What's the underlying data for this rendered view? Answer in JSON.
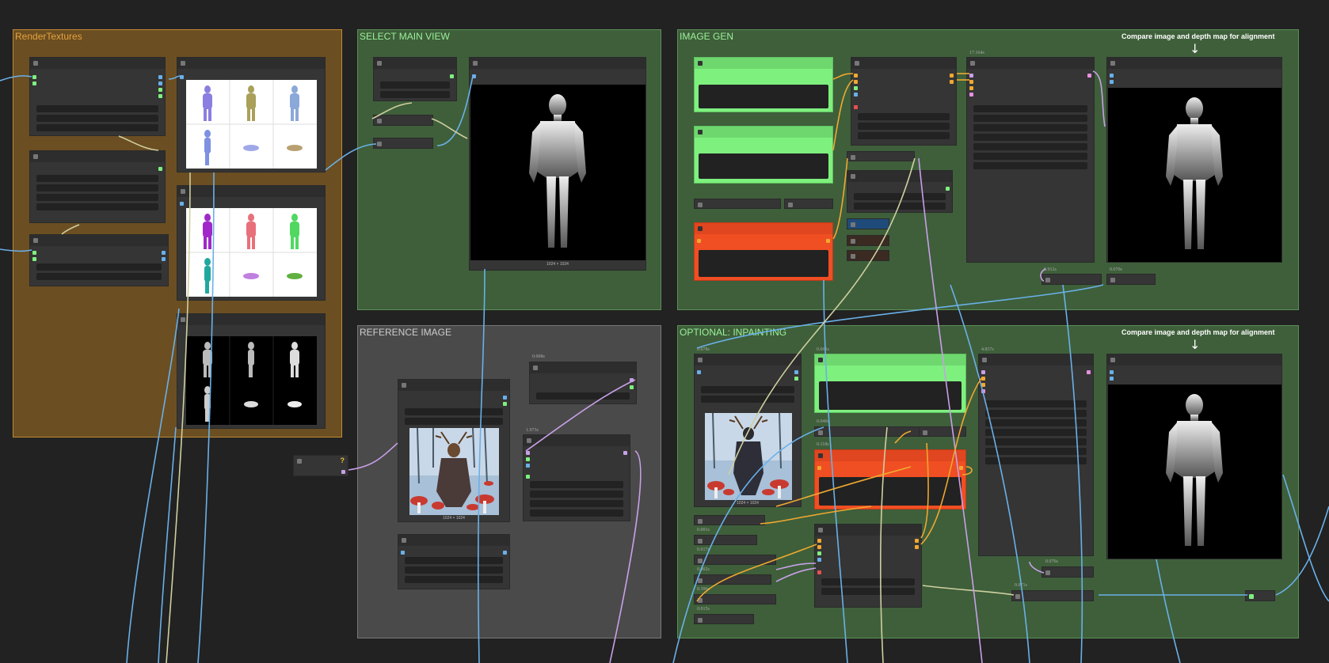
{
  "groups": {
    "render_textures": "RenderTextures",
    "select_main_view": "SELECT MAIN VIEW",
    "image_gen": "IMAGE GEN",
    "reference_image": "REFERENCE IMAGE",
    "inpainting": "OPTIONAL: INPAINTING"
  },
  "notes": {
    "image_gen_alignment": "Compare image and depth map for alignment",
    "inpainting_alignment": "Compare image and depth map for alignment",
    "arrow": "↓"
  },
  "captions": {
    "main_view_size": "1024 × 1024",
    "reference_size": "1024 × 1024",
    "inpaint_size": "1024 × 1024"
  },
  "timings": {
    "sampler": "17.164s",
    "upscale": "0.912s",
    "preview": "0.070s",
    "ref_a": "0.008s",
    "ref_b": "1.973s",
    "inp_a": "0.078s",
    "inp_b": "0.005s",
    "inp_c": "4.837s",
    "inp_d": "0.040s",
    "inp_e": "0.118s",
    "inp_f": "0.001s",
    "inp_g": "0.017s",
    "inp_h": "0.002s",
    "inp_i": "0.396s",
    "inp_j": "0.015s",
    "inp_k": "0.076s",
    "inp_l": "0.071s"
  },
  "badge": "?",
  "colors": {
    "canvas": "#222222",
    "render_group": "#6b4e22",
    "render_title": "#e6a23c",
    "green_group": "#3e5f3a",
    "green_title": "#9cf09c",
    "gray_group": "#4a4a4a",
    "bright_green_node": "#7ef07e",
    "orange_node": "#f04e23",
    "wire_blue": "#6ab0e8",
    "wire_orange": "#f0a830",
    "wire_purple": "#c8a0e8",
    "wire_beige": "#cfcfa0"
  }
}
